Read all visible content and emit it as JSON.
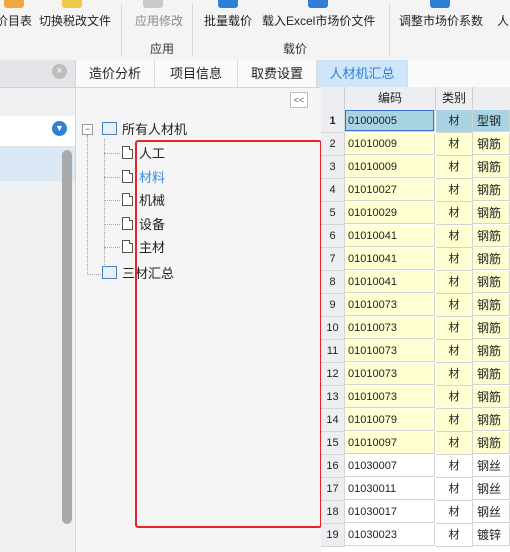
{
  "toolbar": {
    "price_table_label": "价目表",
    "switch_tax_label": "切换税改文件",
    "apply_changes_label": "应用修改",
    "group_apply_label": "应用",
    "batch_price_label": "批量载价",
    "load_excel_label": "载入Excel市场价文件",
    "group_price_label": "载价",
    "adjust_coeff_label": "调整市场价系数",
    "more_label": "人"
  },
  "tabs": [
    {
      "label": "造价分析"
    },
    {
      "label": "项目信息"
    },
    {
      "label": "取费设置"
    },
    {
      "label": "人材机汇总"
    }
  ],
  "tree": {
    "collapse_label": "<<",
    "root": {
      "label": "所有人材机",
      "toggle": "−"
    },
    "children": [
      {
        "label": "人工"
      },
      {
        "label": "材料"
      },
      {
        "label": "机械"
      },
      {
        "label": "设备"
      },
      {
        "label": "主材"
      }
    ],
    "summary": {
      "label": "三材汇总"
    }
  },
  "grid": {
    "headers": {
      "code": "编码",
      "category": "类别",
      "name": ""
    },
    "rows": [
      {
        "n": "1",
        "code": "01000005",
        "cat": "材",
        "name": "型钢"
      },
      {
        "n": "2",
        "code": "01010009",
        "cat": "材",
        "name": "钢筋"
      },
      {
        "n": "3",
        "code": "01010009",
        "cat": "材",
        "name": "钢筋"
      },
      {
        "n": "4",
        "code": "01010027",
        "cat": "材",
        "name": "钢筋"
      },
      {
        "n": "5",
        "code": "01010029",
        "cat": "材",
        "name": "钢筋"
      },
      {
        "n": "6",
        "code": "01010041",
        "cat": "材",
        "name": "钢筋"
      },
      {
        "n": "7",
        "code": "01010041",
        "cat": "材",
        "name": "钢筋"
      },
      {
        "n": "8",
        "code": "01010041",
        "cat": "材",
        "name": "钢筋"
      },
      {
        "n": "9",
        "code": "01010073",
        "cat": "材",
        "name": "钢筋"
      },
      {
        "n": "10",
        "code": "01010073",
        "cat": "材",
        "name": "钢筋"
      },
      {
        "n": "11",
        "code": "01010073",
        "cat": "材",
        "name": "钢筋"
      },
      {
        "n": "12",
        "code": "01010073",
        "cat": "材",
        "name": "钢筋"
      },
      {
        "n": "13",
        "code": "01010073",
        "cat": "材",
        "name": "钢筋"
      },
      {
        "n": "14",
        "code": "01010079",
        "cat": "材",
        "name": "钢筋"
      },
      {
        "n": "15",
        "code": "01010097",
        "cat": "材",
        "name": "钢筋"
      },
      {
        "n": "16",
        "code": "01030007",
        "cat": "材",
        "name": "钢丝"
      },
      {
        "n": "17",
        "code": "01030011",
        "cat": "材",
        "name": "钢丝"
      },
      {
        "n": "18",
        "code": "01030017",
        "cat": "材",
        "name": "钢丝"
      },
      {
        "n": "19",
        "code": "01030023",
        "cat": "材",
        "name": "镀锌"
      }
    ]
  },
  "colors": {
    "accent": "#2e7fd6",
    "highlight_box": "#e8222a",
    "row_yellow": "#ffffd2",
    "row_selected": "#a7d3e3"
  }
}
